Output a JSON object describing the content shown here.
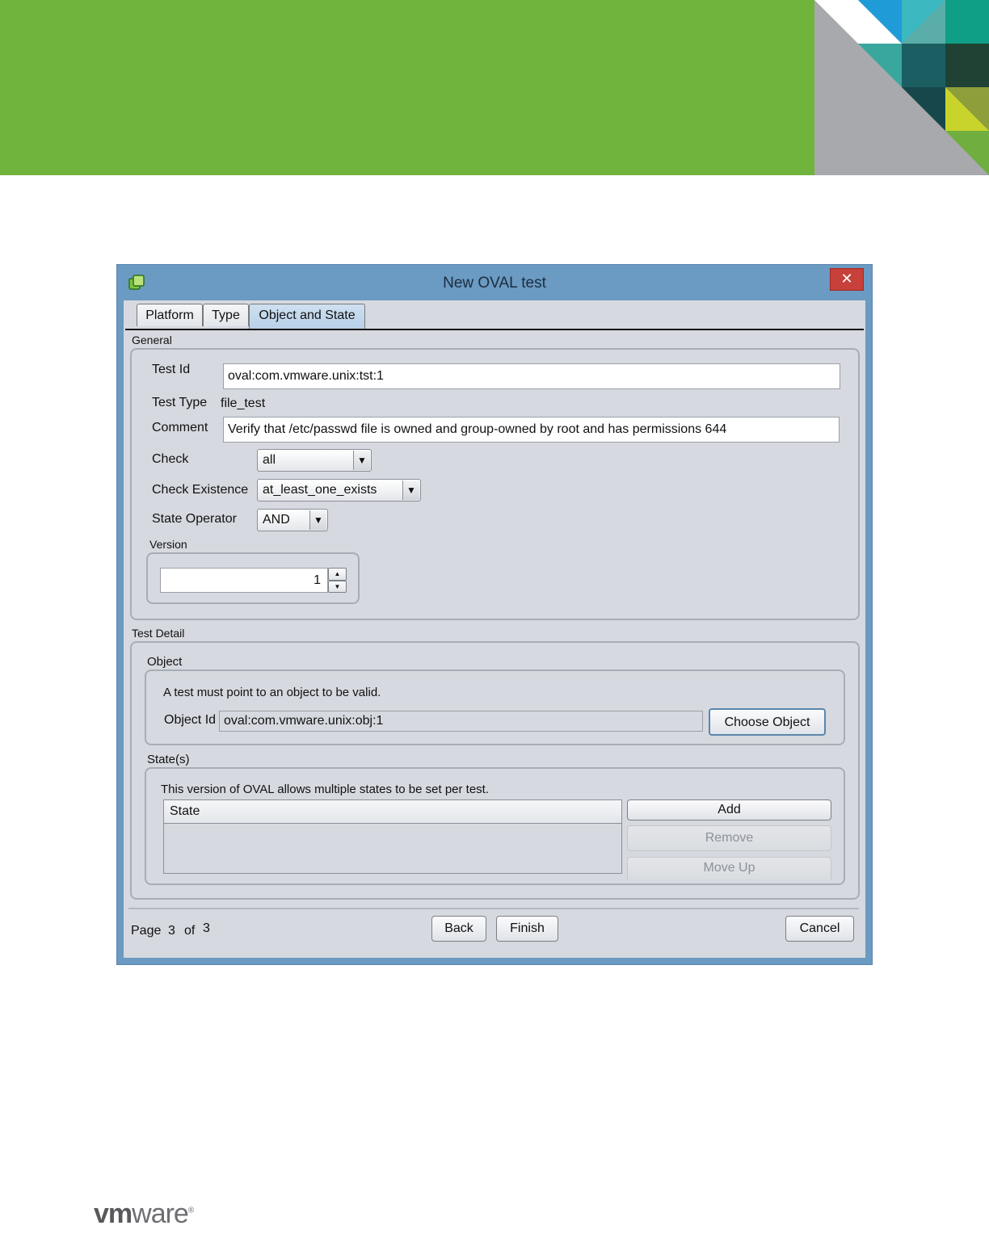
{
  "window": {
    "title": "New OVAL test",
    "close_glyph": "✕"
  },
  "tabs": [
    "Platform",
    "Type",
    "Object and State"
  ],
  "general": {
    "legend": "General",
    "test_id_label": "Test Id",
    "test_id_value": "oval:com.vmware.unix:tst:1",
    "test_type_label": "Test Type",
    "test_type_value": "file_test",
    "comment_label": "Comment",
    "comment_value": "Verify that /etc/passwd file is owned and group-owned by root and has permissions 644",
    "check_label": "Check",
    "check_value": "all",
    "check_existence_label": "Check Existence",
    "check_existence_value": "at_least_one_exists",
    "state_operator_label": "State Operator",
    "state_operator_value": "AND",
    "version_legend": "Version",
    "version_value": "1"
  },
  "test_detail": {
    "legend": "Test Detail",
    "object": {
      "legend": "Object",
      "info": "A test must point to an object to be valid.",
      "object_id_label": "Object Id",
      "object_id_value": "oval:com.vmware.unix:obj:1",
      "choose_button": "Choose Object"
    },
    "states": {
      "legend": "State(s)",
      "info": "This version of OVAL allows multiple states to be set per test.",
      "column_header": "State",
      "add_button": "Add",
      "remove_button": "Remove",
      "move_up_button": "Move Up"
    }
  },
  "footer": {
    "page_label": "Page",
    "page_current": "3",
    "of_label": "of",
    "page_total": "3",
    "back_button": "Back",
    "finish_button": "Finish",
    "cancel_button": "Cancel"
  },
  "branding": {
    "logo_bold": "vm",
    "logo_rest": "ware",
    "logo_mark": "®"
  },
  "colors": {
    "header_green": "#70b43e",
    "window_frame": "#6b9ac2",
    "close_red": "#c7403a"
  },
  "icons": [
    "app-icon",
    "close-icon",
    "dropdown-arrow-icon",
    "spinner-up-icon",
    "spinner-down-icon"
  ]
}
